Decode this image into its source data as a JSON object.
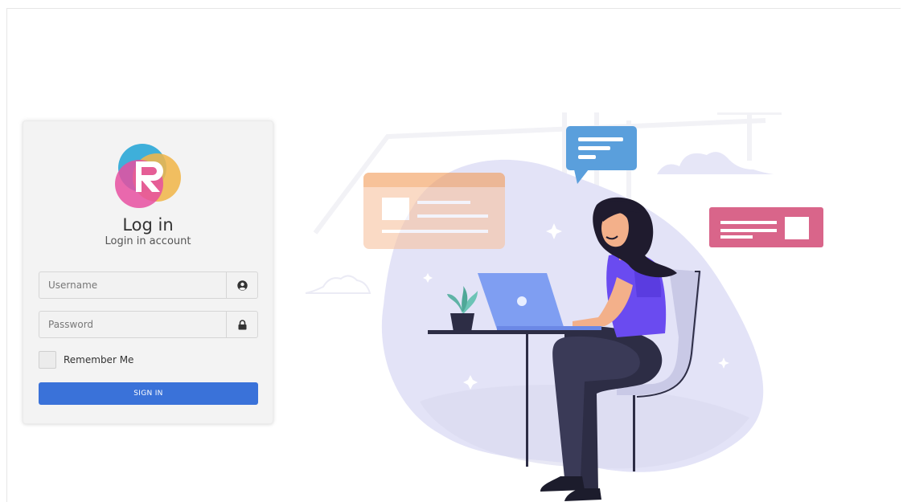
{
  "login": {
    "title": "Log in",
    "subtitle": "Login in account",
    "username": {
      "placeholder": "Username",
      "value": "",
      "icon": "user-circle-icon"
    },
    "password": {
      "placeholder": "Password",
      "value": "",
      "icon": "lock-icon"
    },
    "remember_label": "Remember Me",
    "remember_checked": false,
    "signin_label": "SIGN IN"
  },
  "colors": {
    "primary": "#3a72d9",
    "card_bg": "#f3f3f3",
    "illustration_blob": "#e3e3f7",
    "shirt": "#6a4bf0",
    "pink_card": "#d9658a",
    "orange_card": "#f6a363",
    "chat_bubble": "#5a9fdc"
  },
  "illustration": {
    "name": "woman-working-on-laptop",
    "icons": [
      "chat-bubble-icon",
      "browser-window-card",
      "text-card-icon",
      "plant-icon",
      "cloud-icon"
    ]
  }
}
